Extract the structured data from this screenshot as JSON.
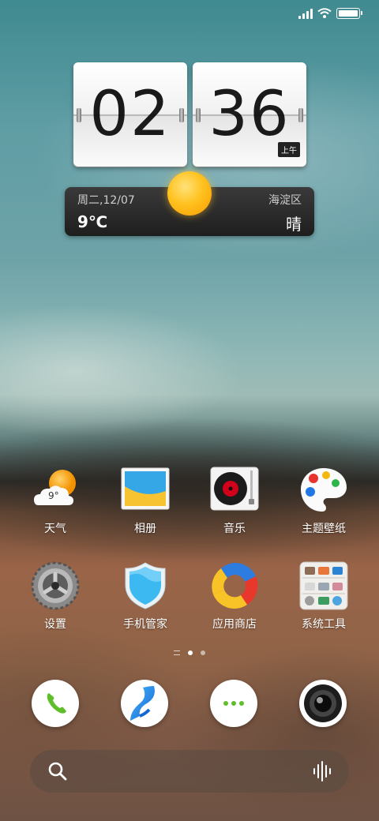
{
  "status_bar": {
    "signal_icon": "cellular-signal-icon",
    "wifi_icon": "wifi-icon",
    "battery_icon": "battery-full-icon"
  },
  "clock": {
    "hour": "02",
    "minute": "36",
    "ampm": "上午"
  },
  "weather_widget": {
    "date": "周二,12/07",
    "location": "海淀区",
    "temperature": "9℃",
    "condition": "晴",
    "icon": "sun-icon"
  },
  "apps": [
    {
      "label": "天气",
      "icon": "weather-icon",
      "badge_text": "9°"
    },
    {
      "label": "相册",
      "icon": "gallery-icon"
    },
    {
      "label": "音乐",
      "icon": "music-icon"
    },
    {
      "label": "主题壁纸",
      "icon": "theme-palette-icon"
    },
    {
      "label": "设置",
      "icon": "settings-gear-icon"
    },
    {
      "label": "手机管家",
      "icon": "phone-manager-shield-icon"
    },
    {
      "label": "应用商店",
      "icon": "app-store-icon"
    },
    {
      "label": "系统工具",
      "icon": "system-tools-folder-icon"
    }
  ],
  "page_indicator": {
    "pages": 2,
    "current": 1
  },
  "dock": [
    {
      "icon": "phone-icon"
    },
    {
      "icon": "browser-icon"
    },
    {
      "icon": "messages-icon"
    },
    {
      "icon": "camera-icon"
    }
  ],
  "search_bar": {
    "search_icon": "search-icon",
    "voice_icon": "voice-search-icon"
  }
}
